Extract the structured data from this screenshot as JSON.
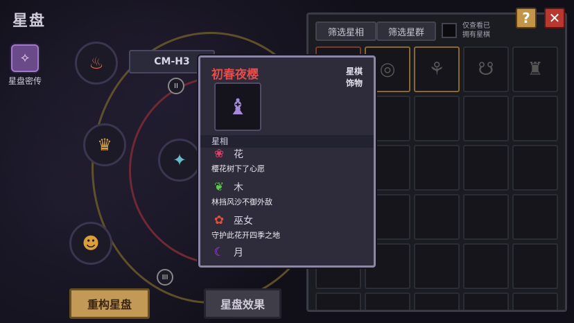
{
  "page_title": "星盘",
  "secret_label": "星盘密传",
  "disk": {
    "code": "CM-H3",
    "roman_top": "II",
    "roman_bottom": "III",
    "nodes": [
      {
        "icon": "flame-mask-icon",
        "glyph": "🔥"
      },
      {
        "icon": "horned-helmet-icon",
        "glyph": "⛑"
      },
      {
        "icon": "skull-icon",
        "glyph": "☻"
      },
      {
        "icon": "leaf-bug-icon",
        "glyph": "✦"
      }
    ]
  },
  "buttons": {
    "rebuild": "重构星盘",
    "effect": "星盘效果"
  },
  "panel": {
    "filter_aspect": "筛选星相",
    "filter_group": "筛选星群",
    "only_owned": "仅查看已\n拥有星棋",
    "help": "?",
    "close": "✕",
    "grid_glyphs": [
      "",
      "◎",
      "⚘",
      "☋",
      "♜"
    ]
  },
  "popup": {
    "name": "初春夜樱",
    "type_top": "星棋",
    "type_bottom": "饰物",
    "section": "星相",
    "aspects": [
      {
        "icon": "butterfly-icon",
        "glyph": "❀",
        "color": "#e0406a",
        "name": "花",
        "desc": "樱花树下了心愿"
      },
      {
        "icon": "green-leaf-icon",
        "glyph": "❦",
        "color": "#5ac84a",
        "name": "木",
        "desc": "林挡风沙不御外敌"
      },
      {
        "icon": "red-beetle-icon",
        "glyph": "✿",
        "color": "#e0503a",
        "name": "巫女",
        "desc": "守护此花开四季之地"
      },
      {
        "icon": "crescent-moon-icon",
        "glyph": "☾",
        "color": "#a04ae0",
        "name": "月",
        "desc": ""
      }
    ]
  },
  "colors": {
    "accent_name": "#e84a4a",
    "rebuild_button": "#c29a55",
    "close_button": "#b8372f"
  }
}
